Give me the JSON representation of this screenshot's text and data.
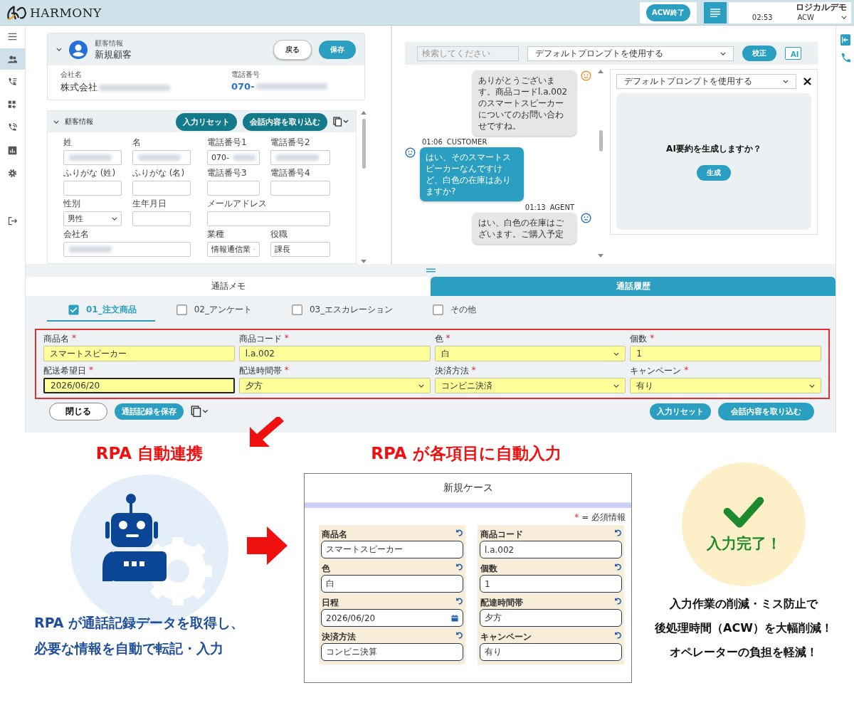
{
  "header": {
    "logo_text": "HARMONY",
    "acw_button": "ACW終了",
    "user_name": "ロジカルデモ",
    "time": "02:53",
    "status": "ACW"
  },
  "nav_items": [
    {
      "selected": false
    },
    {
      "selected": true
    },
    {
      "selected": false
    },
    {
      "selected": false
    },
    {
      "selected": false
    },
    {
      "selected": false
    },
    {
      "selected": false
    },
    {
      "selected": false
    }
  ],
  "customer_card": {
    "caption": "顧客情報",
    "title": "新規顧客",
    "back_button": "戻る",
    "save_button": "保存",
    "company_label": "会社名",
    "company_value": "株式会社",
    "phone_label": "電話番号",
    "phone_value": "070-"
  },
  "customer_section": {
    "title": "顧客情報",
    "reset_button": "入力リセット",
    "import_button": "会話内容を取り込む",
    "fields": [
      {
        "label": "姓",
        "kind": "text",
        "blurred": true
      },
      {
        "label": "名",
        "kind": "text",
        "blurred": true
      },
      {
        "label": "電話番号1",
        "kind": "text",
        "value": "070-",
        "blurred": true
      },
      {
        "label": "電話番号2",
        "kind": "text",
        "blurred": true
      },
      {
        "label": "ふりがな (姓)",
        "kind": "text",
        "blurred": false
      },
      {
        "label": "ふりがな (名)",
        "kind": "text",
        "blurred": false
      },
      {
        "label": "電話番号3",
        "kind": "text",
        "blurred": false
      },
      {
        "label": "電話番号4",
        "kind": "text",
        "blurred": false
      },
      {
        "label": "性別",
        "kind": "select",
        "value": "男性",
        "blurred": false
      },
      {
        "label": "生年月日",
        "kind": "text",
        "blurred": false
      },
      {
        "label": "メールアドレス",
        "kind": "wide",
        "blurred": false
      },
      {
        "label": "会社名",
        "kind": "wide",
        "blurred": true
      },
      {
        "label": "業種",
        "kind": "select",
        "value": "情報通信業",
        "blurred": false
      },
      {
        "label": "役職",
        "kind": "text",
        "value": "課長",
        "blurred": false
      }
    ]
  },
  "chat_toolbar": {
    "search_placeholder": "検索してください",
    "prompt": "デフォルトプロンプトを使用する",
    "proofread_button": "校正",
    "ai_button": "AI"
  },
  "messages": [
    {
      "kind": "agent",
      "text": "ありがとうございます。商品コードl.a.002のスマートスピーカーについてのお問い合わせですね。",
      "color": "#f08a24"
    },
    {
      "kind": "customer",
      "time": "01:06",
      "speaker": "CUSTOMER",
      "text": "はい、そのスマートスピーカーなんですけど、白色の在庫はありますか?",
      "color": "#1f6fb0"
    },
    {
      "kind": "agent",
      "time": "01:13",
      "speaker": "AGENT",
      "text": "はい、白色の在庫はございます。ご購入予定",
      "color": "#1f6fb0"
    }
  ],
  "ai_panel": {
    "prompt": "デフォルトプロンプトを使用する",
    "question": "AI要約を生成しますか？",
    "generate_button": "生成"
  },
  "memo": {
    "tabs": [
      {
        "label": "通話メモ",
        "selected": true
      },
      {
        "label": "通話履歴",
        "selected": false
      }
    ],
    "categories": [
      {
        "label": "01_注文商品",
        "checked": true,
        "selected": true
      },
      {
        "label": "02_アンケート",
        "checked": false,
        "selected": false
      },
      {
        "label": "03_エスカレーション",
        "checked": false,
        "selected": false
      },
      {
        "label": "その他",
        "checked": false,
        "selected": false
      }
    ],
    "fields": [
      {
        "label": "商品名",
        "mark": "*",
        "kind": "text",
        "value": "スマートスピーカー",
        "focused": false
      },
      {
        "label": "商品コード",
        "mark": "*",
        "kind": "text",
        "value": "l.a.002",
        "focused": false
      },
      {
        "label": "色",
        "mark": "*",
        "kind": "select",
        "value": "白",
        "focused": false
      },
      {
        "label": "個数",
        "mark": "*",
        "kind": "text",
        "value": "1",
        "focused": false
      },
      {
        "label": "配送希望日",
        "mark": "*",
        "kind": "text",
        "value": "2026/06/20",
        "focused": true
      },
      {
        "label": "配送時間帯",
        "mark": "*",
        "kind": "select",
        "value": "夕方",
        "focused": false
      },
      {
        "label": "決済方法",
        "mark": "*",
        "kind": "select",
        "value": "コンビニ決済",
        "focused": false
      },
      {
        "label": "キャンペーン",
        "mark": "*",
        "kind": "select",
        "value": "有り",
        "focused": false
      }
    ],
    "close_button": "閉じる",
    "save_button": "通話記録を保存",
    "reset_button": "入力リセット",
    "import_button": "会話内容を取り込む"
  },
  "infographic": {
    "rpa_heading": "RPA 自動連携",
    "rpa_text": [
      "RPA が通話記録データを取得し、",
      "必要な情報を自動で転記・入力"
    ],
    "center_heading": "RPA が各項目に自動入力",
    "case_form": {
      "title": "新規ケース",
      "required_mark": "*",
      "required_note": "= 必須情報",
      "columns": [
        [
          {
            "label": "商品名",
            "kind": "text",
            "value": "スマートスピーカー"
          },
          {
            "label": "色",
            "kind": "text",
            "value": "白"
          },
          {
            "label": "日程",
            "kind": "date",
            "value": "2026/06/20"
          },
          {
            "label": "決済方法",
            "kind": "text",
            "value": "コンビニ決算"
          }
        ],
        [
          {
            "label": "商品コード",
            "kind": "text",
            "value": "l.a.002"
          },
          {
            "label": "個数",
            "kind": "text",
            "value": "1"
          },
          {
            "label": "配達時間帯",
            "kind": "text",
            "value": "夕方"
          },
          {
            "label": "キャンペーン",
            "kind": "text",
            "value": "有り"
          }
        ]
      ]
    },
    "done_text": "入力完了！",
    "summary": [
      "入力作業の削減・ミス防止で",
      "後処理時間（ACW）を大幅削減！",
      "オペレーターの負担を軽減！"
    ]
  }
}
